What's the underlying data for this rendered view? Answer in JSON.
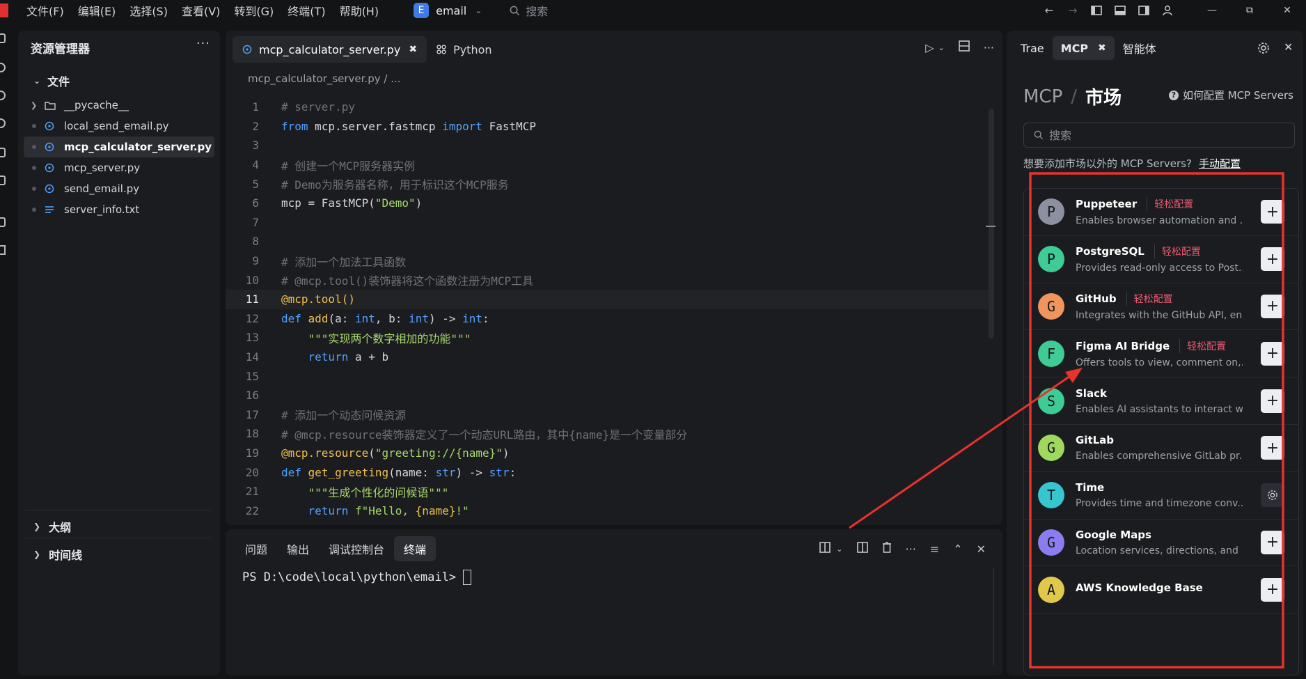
{
  "titlebar": {
    "menu": [
      "文件(F)",
      "编辑(E)",
      "选择(S)",
      "查看(V)",
      "转到(G)",
      "终端(T)",
      "帮助(H)"
    ],
    "workspace_initial": "E",
    "workspace_name": "email",
    "search_label": "搜索"
  },
  "explorer": {
    "title": "资源管理器",
    "more": "···",
    "section": "文件",
    "files": [
      {
        "name": "__pycache__",
        "kind": "folder"
      },
      {
        "name": "local_send_email.py",
        "kind": "py"
      },
      {
        "name": "mcp_calculator_server.py",
        "kind": "py",
        "active": true
      },
      {
        "name": "mcp_server.py",
        "kind": "py"
      },
      {
        "name": "send_email.py",
        "kind": "py"
      },
      {
        "name": "server_info.txt",
        "kind": "txt"
      }
    ],
    "outline": "大纲",
    "timeline": "时间线"
  },
  "editor": {
    "tab_active": "mcp_calculator_server.py",
    "tab_python": "Python",
    "breadcrumb": "mcp_calculator_server.py / ...",
    "current_line": 11,
    "lines": [
      [
        [
          "c-com",
          "# server.py"
        ]
      ],
      [
        [
          "c-kw",
          "from"
        ],
        [
          "",
          " mcp.server.fastmcp "
        ],
        [
          "c-kw",
          "import"
        ],
        [
          "",
          " FastMCP"
        ]
      ],
      [],
      [
        [
          "c-com",
          "# 创建一个MCP服务器实例"
        ]
      ],
      [
        [
          "c-com",
          "# Demo为服务器名称，用于标识这个MCP服务"
        ]
      ],
      [
        [
          "",
          "mcp = FastMCP("
        ],
        [
          "c-str",
          "\"Demo\""
        ],
        [
          "",
          ")"
        ]
      ],
      [],
      [],
      [
        [
          "c-com",
          "# 添加一个加法工具函数"
        ]
      ],
      [
        [
          "c-com",
          "# @mcp.tool()装饰器将这个函数注册为MCP工具"
        ]
      ],
      [
        [
          "c-dec",
          "@mcp.tool()"
        ]
      ],
      [
        [
          "c-kw",
          "def"
        ],
        [
          "",
          " "
        ],
        [
          "c-fn",
          "add"
        ],
        [
          "",
          "(a: "
        ],
        [
          "c-type",
          "int"
        ],
        [
          "",
          ", b: "
        ],
        [
          "c-type",
          "int"
        ],
        [
          "",
          ") -> "
        ],
        [
          "c-type",
          "int"
        ],
        [
          "",
          ":"
        ]
      ],
      [
        [
          "",
          "    "
        ],
        [
          "c-str",
          "\"\"\"实现两个数字相加的功能\"\"\""
        ]
      ],
      [
        [
          "",
          "    "
        ],
        [
          "c-kw",
          "return"
        ],
        [
          "",
          " a + b"
        ]
      ],
      [],
      [],
      [
        [
          "c-com",
          "# 添加一个动态问候资源"
        ]
      ],
      [
        [
          "c-com",
          "# @mcp.resource装饰器定义了一个动态URL路由，其中{name}是一个变量部分"
        ]
      ],
      [
        [
          "c-dec",
          "@mcp.resource"
        ],
        [
          "",
          "("
        ],
        [
          "c-str",
          "\"greeting://{name}\""
        ],
        [
          "",
          ")"
        ]
      ],
      [
        [
          "c-kw",
          "def"
        ],
        [
          "",
          " "
        ],
        [
          "c-fn",
          "get_greeting"
        ],
        [
          "",
          "(name: "
        ],
        [
          "c-type",
          "str"
        ],
        [
          "",
          ") -> "
        ],
        [
          "c-type",
          "str"
        ],
        [
          "",
          ":"
        ]
      ],
      [
        [
          "",
          "    "
        ],
        [
          "c-str",
          "\"\"\"生成个性化的问候语\"\"\""
        ]
      ],
      [
        [
          "",
          "    "
        ],
        [
          "c-kw",
          "return"
        ],
        [
          "",
          " "
        ],
        [
          "c-str",
          "f\"Hello, "
        ],
        [
          "c-fn",
          "{name}"
        ],
        [
          "c-str",
          "!\""
        ]
      ]
    ]
  },
  "panel": {
    "tabs": [
      "问题",
      "输出",
      "调试控制台",
      "终端"
    ],
    "active_tab": "终端",
    "prompt": "PS D:\\code\\local\\python\\email>"
  },
  "right": {
    "tabs": [
      "Trae",
      "MCP",
      "智能体"
    ],
    "active_tab": "MCP",
    "title_a": "MCP",
    "title_sep": "/",
    "title_b": "市场",
    "howto": "如何配置 MCP Servers",
    "search_placeholder": "搜索",
    "manual_text": "想要添加市场以外的 MCP Servers?",
    "manual_link": "手动配置",
    "servers": [
      {
        "initial": "P",
        "name": "Puppeteer",
        "badge": "轻松配置",
        "desc": "Enables browser automation and ...",
        "color": "#8d90a0",
        "action": "add"
      },
      {
        "initial": "P",
        "name": "PostgreSQL",
        "badge": "轻松配置",
        "desc": "Provides read-only access to Post...",
        "color": "#3ecb95",
        "action": "add"
      },
      {
        "initial": "G",
        "name": "GitHub",
        "badge": "轻松配置",
        "desc": "Integrates with the GitHub API, en...",
        "color": "#f0955e",
        "action": "add"
      },
      {
        "initial": "F",
        "name": "Figma AI Bridge",
        "badge": "轻松配置",
        "desc": "Offers tools to view, comment on,...",
        "color": "#3ecb95",
        "action": "add"
      },
      {
        "initial": "S",
        "name": "Slack",
        "badge": "",
        "desc": "Enables AI assistants to interact wi...",
        "color": "#3ecb95",
        "action": "add"
      },
      {
        "initial": "G",
        "name": "GitLab",
        "badge": "",
        "desc": "Enables comprehensive GitLab pr...",
        "color": "#9ed85f",
        "action": "add"
      },
      {
        "initial": "T",
        "name": "Time",
        "badge": "",
        "desc": "Provides time and timezone conv...",
        "color": "#37c6cf",
        "action": "settings"
      },
      {
        "initial": "G",
        "name": "Google Maps",
        "badge": "",
        "desc": "Location services, directions, and ...",
        "color": "#8b7cf0",
        "action": "add"
      },
      {
        "initial": "A",
        "name": "AWS Knowledge Base",
        "badge": "",
        "desc": "",
        "color": "#e0c84a",
        "action": "add"
      }
    ]
  },
  "annotation": {
    "color": "#e8322c"
  }
}
